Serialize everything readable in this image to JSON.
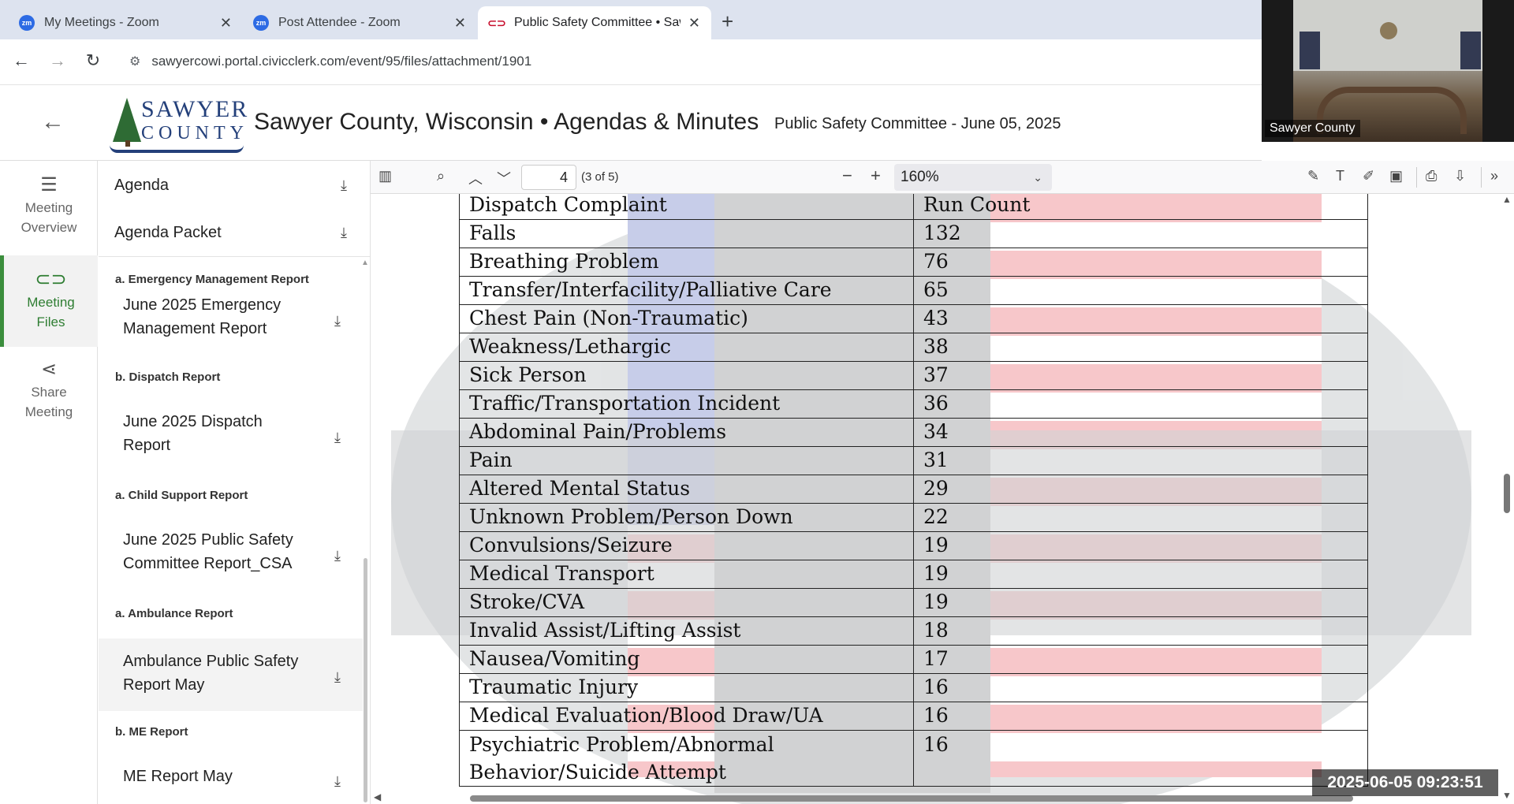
{
  "browser": {
    "tabs": [
      {
        "label": "My Meetings - Zoom",
        "favicon": "zm"
      },
      {
        "label": "Post Attendee - Zoom",
        "favicon": "zm"
      },
      {
        "label": "Public Safety Committee • Saw",
        "favicon": "civicclerk"
      }
    ],
    "url": "sawyercowi.portal.civicclerk.com/event/95/files/attachment/1901"
  },
  "video": {
    "participant_name": "Sawyer County"
  },
  "header": {
    "logo_line1": "SAWYER",
    "logo_line2": "COUNTY",
    "site_title": "Sawyer County, Wisconsin • Agendas & Minutes",
    "meeting_title": "Public Safety Committee - June 05, 2025"
  },
  "rail": {
    "items": [
      {
        "label_line1": "Meeting",
        "label_line2": "Overview",
        "icon": "list-icon"
      },
      {
        "label_line1": "Meeting",
        "label_line2": "Files",
        "icon": "paperclip-icon"
      },
      {
        "label_line1": "Share",
        "label_line2": "Meeting",
        "icon": "share-icon"
      }
    ]
  },
  "files": {
    "agenda": "Agenda",
    "agenda_packet": "Agenda Packet",
    "sections": [
      {
        "label": "a. Emergency Management Report",
        "item_line1": "June 2025 Emergency",
        "item_line2": "Management Report"
      },
      {
        "label": "b. Dispatch Report",
        "item_line1": "June 2025 Dispatch",
        "item_line2": "Report"
      },
      {
        "label": "a. Child Support Report",
        "item_line1": "June 2025 Public Safety",
        "item_line2": "Committee Report_CSA"
      },
      {
        "label": "a. Ambulance Report",
        "item_line1": "Ambulance Public Safety",
        "item_line2": "Report May"
      },
      {
        "label": "b. ME Report",
        "item_line1": "ME Report May",
        "item_line2": ""
      }
    ]
  },
  "pdf": {
    "page_number": "4",
    "page_of": "(3 of 5)",
    "zoom": "160%",
    "table": {
      "headers": [
        "Dispatch Complaint",
        "Run Count"
      ],
      "rows": [
        [
          "Falls",
          "132"
        ],
        [
          "Breathing Problem",
          "76"
        ],
        [
          "Transfer/Interfacility/Palliative Care",
          "65"
        ],
        [
          "Chest Pain (Non-Traumatic)",
          "43"
        ],
        [
          "Weakness/Lethargic",
          "38"
        ],
        [
          "Sick Person",
          "37"
        ],
        [
          "Traffic/Transportation Incident",
          "36"
        ],
        [
          "Abdominal Pain/Problems",
          "34"
        ],
        [
          "Pain",
          "31"
        ],
        [
          "Altered Mental Status",
          "29"
        ],
        [
          "Unknown Problem/Person Down",
          "22"
        ],
        [
          "Convulsions/Seizure",
          "19"
        ],
        [
          "Medical Transport",
          "19"
        ],
        [
          "Stroke/CVA",
          "19"
        ],
        [
          "Invalid Assist/Lifting Assist",
          "18"
        ],
        [
          "Nausea/Vomiting",
          "17"
        ],
        [
          "Traumatic Injury",
          "16"
        ],
        [
          "Medical Evaluation/Blood Draw/UA",
          "16"
        ]
      ],
      "last_row": {
        "line1": "Psychiatric Problem/Abnormal",
        "line2": "Behavior/Suicide Attempt",
        "count": "16"
      }
    }
  },
  "timestamp": "2025-06-05  09:23:51"
}
